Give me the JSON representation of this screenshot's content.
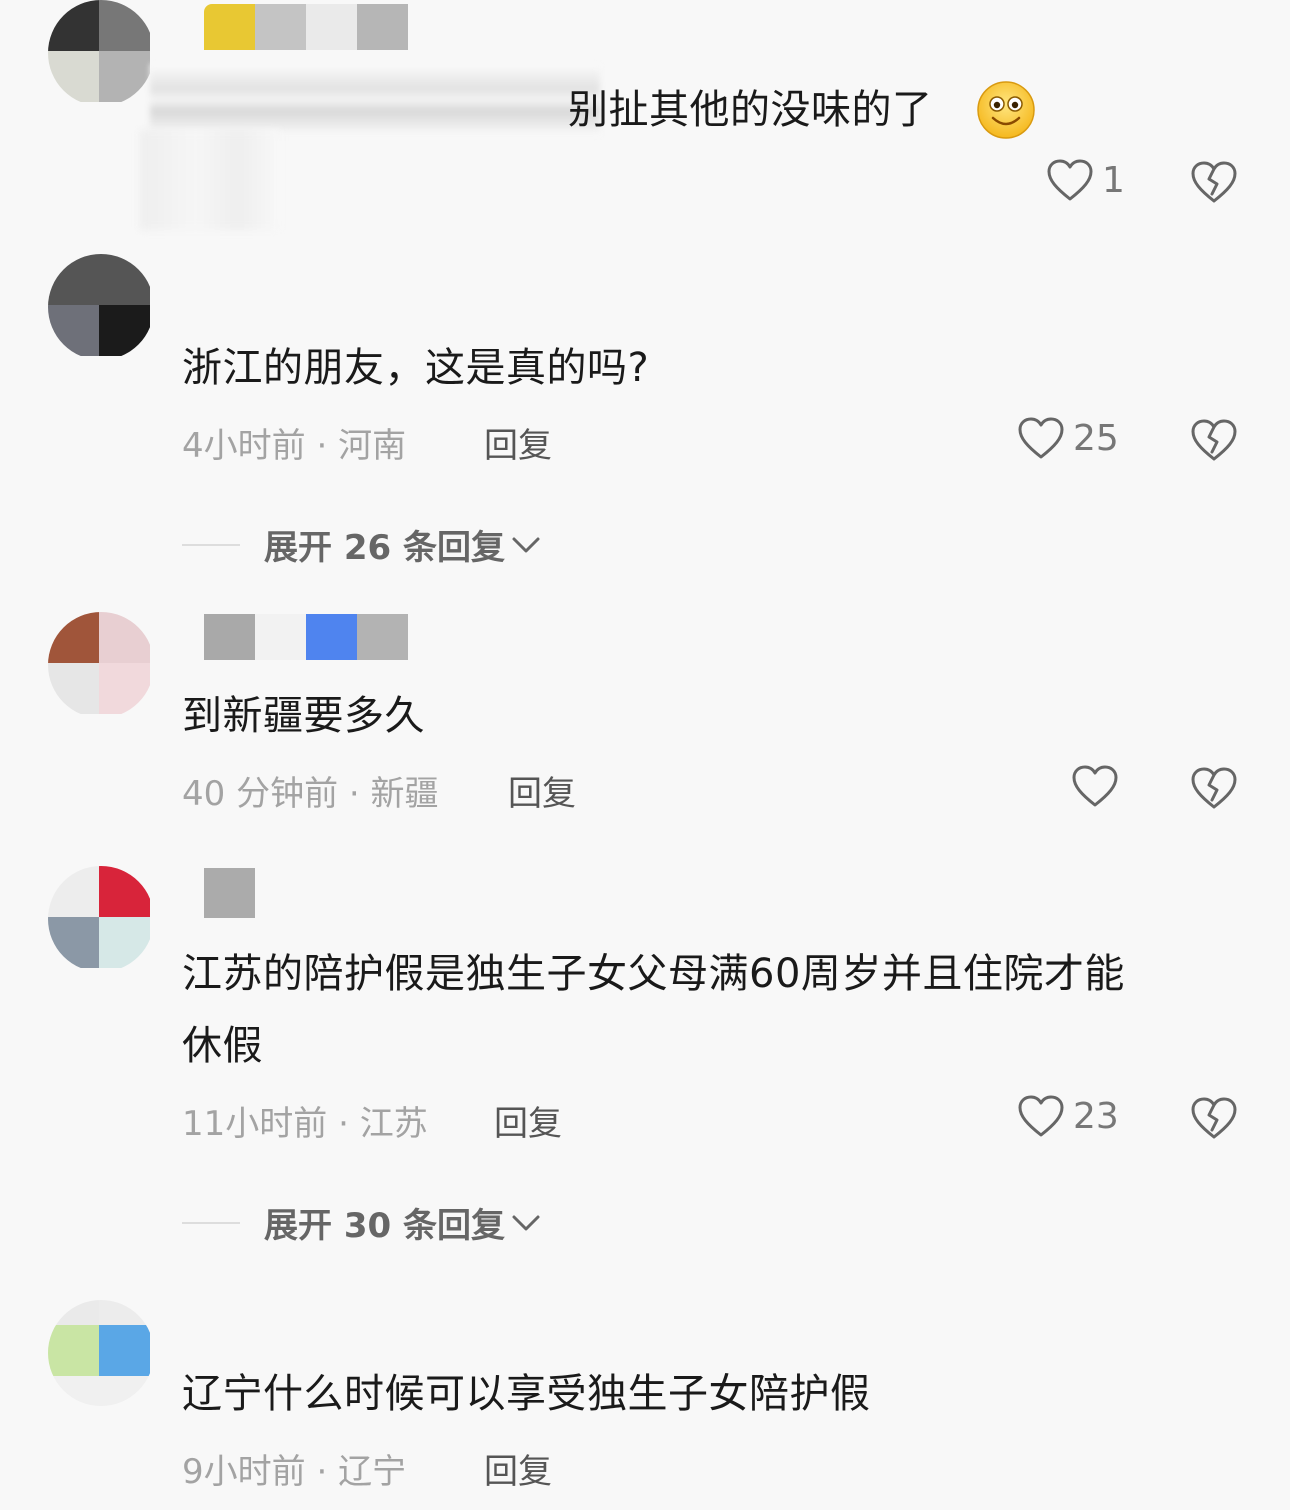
{
  "comments": [
    {
      "text": "别扯其他的没味的了",
      "likes": "1"
    },
    {
      "text": "浙江的朋友，这是真的吗?",
      "time": "4小时前",
      "location": "河南",
      "reply_label": "回复",
      "likes": "25",
      "expand_label": "展开 26 条回复"
    },
    {
      "text": "到新疆要多久",
      "time": "40 分钟前",
      "location": "新疆",
      "reply_label": "回复",
      "likes": ""
    },
    {
      "text_line1": "江苏的陪护假是独生子女父母满60周岁并且住院才能",
      "text_line2": "休假",
      "time": "11小时前",
      "location": "江苏",
      "reply_label": "回复",
      "likes": "23",
      "expand_label": "展开 30 条回复"
    },
    {
      "text": "辽宁什么时候可以享受独生子女陪护假",
      "time": "9小时前",
      "location": "辽宁",
      "reply_label": "回复"
    }
  ],
  "separator": " · ",
  "icons": {
    "like": "heart-outline-icon",
    "dislike": "broken-heart-icon",
    "expand": "chevron-down-icon",
    "emoji": "smiley-emoji-icon"
  },
  "colors": {
    "text": "#1a1a1a",
    "meta": "#a3a3a3",
    "icon": "#666666"
  }
}
